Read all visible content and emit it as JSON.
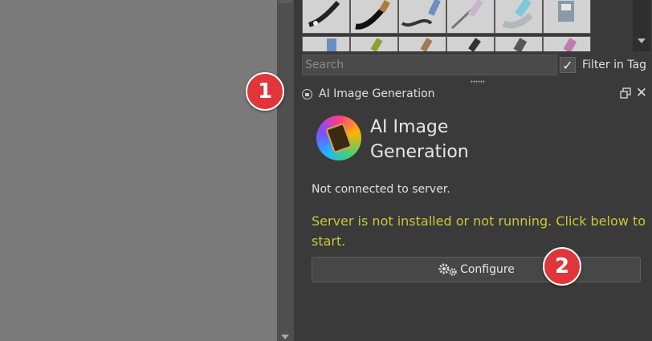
{
  "search": {
    "placeholder": "Search"
  },
  "filter": {
    "label": "Filter in Tag",
    "checked": true,
    "check_glyph": "✓"
  },
  "dock": {
    "title": "AI Image Generation",
    "lock_icon": "lock-icon",
    "float_icon": "float-icon",
    "close_glyph": "✕"
  },
  "plugin": {
    "title": "AI Image Generation",
    "status": "Not connected to server.",
    "warning": "Server is not installed or not running. Click below to start.",
    "configure_label": "Configure",
    "warning_color": "#c8c83a"
  },
  "annotations": [
    {
      "label": "1"
    },
    {
      "label": "2"
    }
  ]
}
